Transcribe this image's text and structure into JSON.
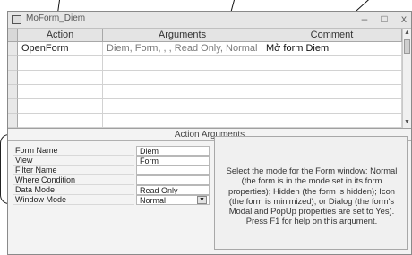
{
  "window": {
    "title": "MoForm_Diem",
    "controls": {
      "minimize": "–",
      "maximize": "□",
      "close": "x"
    }
  },
  "grid": {
    "headers": [
      "Action",
      "Arguments",
      "Comment"
    ],
    "row": {
      "action": "OpenForm",
      "arguments": "Diem, Form, , , Read Only, Normal",
      "comment": "Mở form Diem"
    }
  },
  "action_arguments": {
    "title": "Action Arguments",
    "properties": [
      {
        "label": "Form Name",
        "value": "Diem"
      },
      {
        "label": "View",
        "value": "Form"
      },
      {
        "label": "Filter Name",
        "value": ""
      },
      {
        "label": "Where Condition",
        "value": ""
      },
      {
        "label": "Data Mode",
        "value": "Read Only"
      },
      {
        "label": "Window Mode",
        "value": "Normal"
      }
    ],
    "help": "Select the mode for the Form window: Normal (the form is in the mode set in its form properties); Hidden (the form is hidden); Icon (the form is minimized); or Dialog (the form's Modal and PopUp properties are set to Yes). Press F1 for help on this argument."
  },
  "icons": {
    "app": "macro-icon",
    "dropdown": "chevron-down-icon"
  }
}
